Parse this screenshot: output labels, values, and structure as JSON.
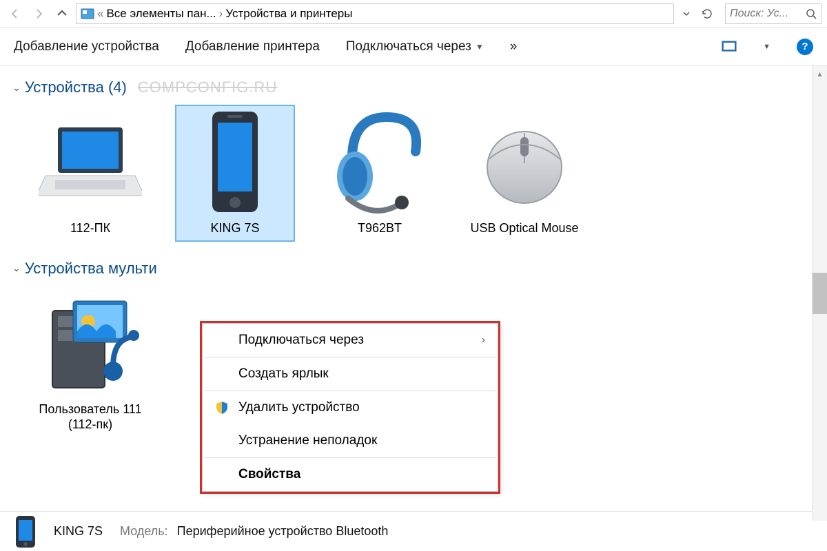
{
  "breadcrumb": {
    "segment1": "Все элементы пан...",
    "segment2": "Устройства и принтеры"
  },
  "search": {
    "placeholder": "Поиск: Ус..."
  },
  "toolbar": {
    "add_device": "Добавление устройства",
    "add_printer": "Добавление принтера",
    "connect_via": "Подключаться через",
    "overflow": "»"
  },
  "groups": {
    "devices_label": "Устройства (4)",
    "multimedia_label": "Устройства мульти",
    "watermark": "COMPCONFIG.RU"
  },
  "devices": [
    {
      "name": "112-ПК"
    },
    {
      "name": "KING 7S"
    },
    {
      "name": "T962BT"
    },
    {
      "name": "USB Optical Mouse"
    }
  ],
  "media_devices": [
    {
      "name": "Пользователь 111 (112-пк)"
    }
  ],
  "context_menu": {
    "connect_via": "Подключаться через",
    "create_shortcut": "Создать ярлык",
    "remove_device": "Удалить устройство",
    "troubleshoot": "Устранение неполадок",
    "properties": "Свойства"
  },
  "status": {
    "title": "KING 7S",
    "model_label": "Модель:",
    "model_value": "Периферийное устройство Bluetooth"
  }
}
